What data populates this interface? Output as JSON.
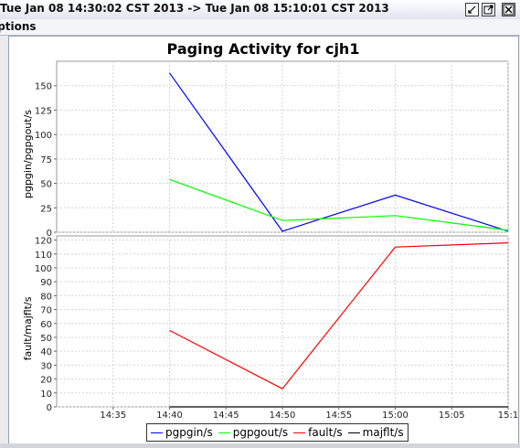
{
  "window": {
    "title": "Tue Jan 08 14:30:02 CST 2013 -> Tue Jan 08 15:10:01 CST 2013",
    "menu_label": "Options",
    "title_icons": [
      "restore-icon",
      "maximize-icon",
      "close-icon"
    ]
  },
  "chart_data": {
    "type": "line",
    "title": "Paging Activity for cjh1",
    "x": [
      "14:40",
      "14:50",
      "15:00",
      "15:10"
    ],
    "xticks": [
      "14:35",
      "14:40",
      "14:45",
      "14:50",
      "14:55",
      "15:00",
      "15:05",
      "15:1"
    ],
    "xlim": [
      "14:30",
      "15:10"
    ],
    "grid": true,
    "legend_position": "bottom",
    "panels": [
      {
        "ylabel": "pgpgin/pgpgout/s",
        "ylim": [
          0,
          175
        ],
        "yticks": [
          0,
          25,
          50,
          75,
          100,
          125,
          150
        ],
        "series": [
          {
            "name": "pgpgin/s",
            "color": "#0000ff",
            "values": [
              163,
              1,
              38,
              1
            ]
          },
          {
            "name": "pgpgout/s",
            "color": "#00ff00",
            "values": [
              54,
              12,
              17,
              2
            ]
          }
        ]
      },
      {
        "ylabel": "fault/majflt/s",
        "ylim": [
          0,
          123
        ],
        "yticks": [
          0,
          10,
          20,
          30,
          40,
          50,
          60,
          70,
          80,
          90,
          100,
          110,
          120
        ],
        "series": [
          {
            "name": "fault/s",
            "color": "#ff0000",
            "values": [
              55,
              13,
              115,
              118
            ]
          },
          {
            "name": "majflt/s",
            "color": "#000000",
            "values": [
              0,
              0,
              0,
              0
            ]
          }
        ]
      }
    ],
    "legend": [
      "pgpgin/s",
      "pgpgout/s",
      "fault/s",
      "majflt/s"
    ]
  }
}
